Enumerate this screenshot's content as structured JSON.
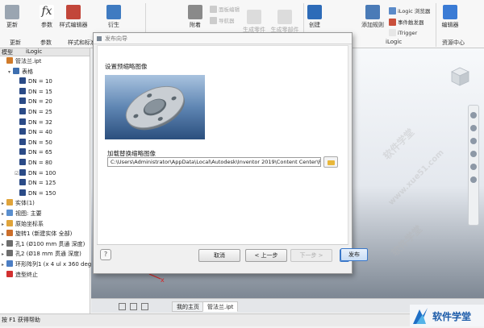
{
  "ribbon": {
    "buttons": [
      {
        "label": "更新",
        "color": "#9aa5b1"
      },
      {
        "label": "参数",
        "color": "#3b3b3b"
      },
      {
        "label": "样式编辑器",
        "color": "#c2463a"
      },
      {
        "label": "衍生",
        "color": "#3f7bc1"
      },
      {
        "label": "附着",
        "color": "#8a8a8a"
      },
      {
        "label": "生成零件",
        "color": "#b9b9b9"
      },
      {
        "label": "生成零部件",
        "color": "#b9b9b9"
      },
      {
        "label": "创建",
        "color": "#2d6bb8"
      },
      {
        "label": "添加规则",
        "color": "#4a7bb7"
      },
      {
        "label": "编辑器",
        "color": "#3a7bd5"
      }
    ],
    "small_items": [
      "面板编辑",
      "导航器",
      "iLogic 浏览器",
      "事件触发器",
      "iTrigger"
    ],
    "groups": [
      "更新",
      "参数",
      "样式和标准",
      "iLogic",
      "资源中心"
    ]
  },
  "browser": {
    "tabs": [
      "模型",
      "iLogic"
    ],
    "tree": [
      {
        "label": "管法兰.ipt",
        "indent": 0,
        "icon": "#d07b2a",
        "arrow": ""
      },
      {
        "label": "表格",
        "indent": 1,
        "icon": "#3e6fb0",
        "arrow": "▾"
      },
      {
        "label": "DN = 10",
        "indent": 2,
        "icon": "#2b4b87",
        "arrow": ""
      },
      {
        "label": "DN = 15",
        "indent": 2,
        "icon": "#2b4b87",
        "arrow": ""
      },
      {
        "label": "DN = 20",
        "indent": 2,
        "icon": "#2b4b87",
        "arrow": ""
      },
      {
        "label": "DN = 25",
        "indent": 2,
        "icon": "#2b4b87",
        "arrow": ""
      },
      {
        "label": "DN = 32",
        "indent": 2,
        "icon": "#2b4b87",
        "arrow": ""
      },
      {
        "label": "DN = 40",
        "indent": 2,
        "icon": "#2b4b87",
        "arrow": ""
      },
      {
        "label": "DN = 50",
        "indent": 2,
        "icon": "#2b4b87",
        "arrow": ""
      },
      {
        "label": "DN = 65",
        "indent": 2,
        "icon": "#2b4b87",
        "arrow": ""
      },
      {
        "label": "DN = 80",
        "indent": 2,
        "icon": "#2b4b87",
        "arrow": ""
      },
      {
        "label": "DN = 100",
        "indent": 2,
        "icon": "#2b4b87",
        "arrow": "☑"
      },
      {
        "label": "DN = 125",
        "indent": 2,
        "icon": "#2b4b87",
        "arrow": ""
      },
      {
        "label": "DN = 150",
        "indent": 2,
        "icon": "#2b4b87",
        "arrow": ""
      },
      {
        "label": "实体(1)",
        "indent": 0,
        "icon": "#e0a43b",
        "arrow": "▸"
      },
      {
        "label": "视图: 主要",
        "indent": 0,
        "icon": "#5a8fcf",
        "arrow": "▸"
      },
      {
        "label": "原始坐标系",
        "indent": 0,
        "icon": "#e0a43b",
        "arrow": "▸"
      },
      {
        "label": "旋转1 (新建实体 全部)",
        "indent": 0,
        "icon": "#cc6f2b",
        "arrow": "▸"
      },
      {
        "label": "孔1 (Ø100 mm 贯通 深度)",
        "indent": 0,
        "icon": "#6d6d6d",
        "arrow": "▸"
      },
      {
        "label": "孔2 (Ø18 mm 贯通 深度)",
        "indent": 0,
        "icon": "#6d6d6d",
        "arrow": "▸"
      },
      {
        "label": "环形阵列1 (x 4 ul x 360 deg)",
        "indent": 0,
        "icon": "#4c7ec4",
        "arrow": "▸"
      },
      {
        "label": "造型终止",
        "indent": 0,
        "icon": "#d23030",
        "arrow": ""
      }
    ]
  },
  "dialog": {
    "title": "发布向导",
    "thumb_label": "设置预缩略图像",
    "path_label": "加载替换缩略图像",
    "path_value": "C:\\Users\\Administrator\\AppData\\Local\\Autodesk\\Inventor 2019\\Content Center\\PC\\",
    "help": "?",
    "cancel": "取消",
    "prev": "< 上一步",
    "next": "下一步 >",
    "publish": "发布"
  },
  "doc_tabs": {
    "tabs": [
      "我的主页",
      "管法兰.ipt"
    ]
  },
  "status": {
    "text": "按 F1 获得帮助"
  },
  "watermark": {
    "texts": [
      "软件学堂",
      "www.xue51.com"
    ]
  },
  "logo": {
    "text": "软件学堂"
  }
}
